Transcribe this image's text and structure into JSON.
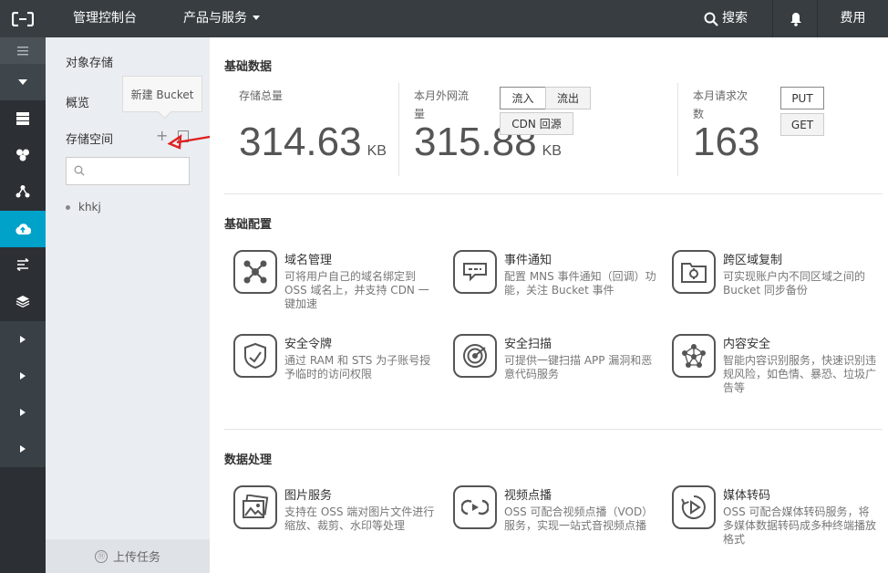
{
  "topbar": {
    "console": "管理控制台",
    "products": "产品与服务",
    "search": "搜索",
    "fee": "费用"
  },
  "sidebar": {
    "title": "对象存储",
    "overview": "概览",
    "tooltip": "新建 Bucket",
    "storage_space": "存储空间",
    "search_placeholder": "",
    "buckets": [
      "khkj"
    ],
    "upload": "上传任务"
  },
  "main": {
    "basic_data": {
      "title": "基础数据",
      "storage": {
        "label": "存储总量",
        "value": "314.63",
        "unit": "KB"
      },
      "traffic": {
        "label": "本月外网流量",
        "value": "315.88",
        "unit": "KB",
        "buttons": [
          "流入",
          "流出",
          "CDN 回源"
        ]
      },
      "requests": {
        "label": "本月请求次数",
        "value": "163",
        "buttons": [
          "PUT",
          "GET"
        ]
      }
    },
    "basic_config": {
      "title": "基础配置",
      "items": [
        {
          "name": "域名管理",
          "desc": "可将用户自己的域名绑定到 OSS 域名上，并支持 CDN 一键加速",
          "icon": "domain-icon"
        },
        {
          "name": "事件通知",
          "desc": "配置 MNS 事件通知（回调）功能，关注 Bucket 事件",
          "icon": "event-icon"
        },
        {
          "name": "跨区域复制",
          "desc": "可实现账户内不同区域之间的 Bucket 同步备份",
          "icon": "replication-icon"
        },
        {
          "name": "安全令牌",
          "desc": "通过 RAM 和 STS 为子账号授予临时的访问权限",
          "icon": "token-icon"
        },
        {
          "name": "安全扫描",
          "desc": "可提供一键扫描 APP 漏洞和恶意代码服务",
          "icon": "scan-icon"
        },
        {
          "name": "内容安全",
          "desc": "智能内容识别服务，快速识别违规风险，如色情、暴恐、垃圾广告等",
          "icon": "content-icon"
        }
      ]
    },
    "data_processing": {
      "title": "数据处理",
      "items": [
        {
          "name": "图片服务",
          "desc": "支持在 OSS 端对图片文件进行缩放、裁剪、水印等处理",
          "icon": "image-icon"
        },
        {
          "name": "视频点播",
          "desc": "OSS 可配合视频点播（VOD）服务，实现一站式音视频点播",
          "icon": "video-icon"
        },
        {
          "name": "媒体转码",
          "desc": "OSS 可配合媒体转码服务，将多媒体数据转码成多种终端播放格式",
          "icon": "transcode-icon"
        }
      ]
    }
  },
  "colors": {
    "topbar": "#373d41",
    "rail": "#2c3035",
    "active": "#00a2ca",
    "sidebar": "#eaedf1",
    "annotation": "#e02020"
  }
}
